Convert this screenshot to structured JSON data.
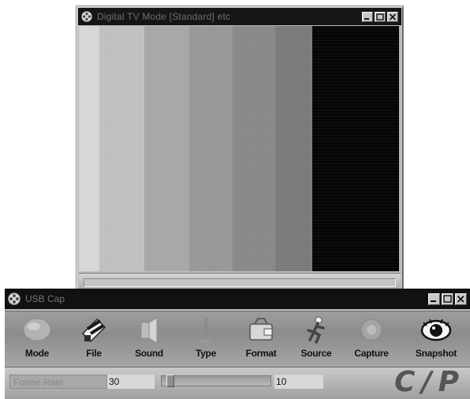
{
  "preview_window": {
    "title": "Digital TV Mode [Standard] etc",
    "color_bars": [
      {
        "color": "#d9d9d9",
        "fraction": 0.065
      },
      {
        "color": "#c2c2c2",
        "fraction": 0.14
      },
      {
        "color": "#a9a9a9",
        "fraction": 0.14
      },
      {
        "color": "#999999",
        "fraction": 0.135
      },
      {
        "color": "#8a8a8a",
        "fraction": 0.135
      },
      {
        "color": "#7c7c7c",
        "fraction": 0.115
      },
      {
        "color": "#060606",
        "fraction": 0.27
      }
    ]
  },
  "toolbar_window": {
    "title": "USB Cap",
    "tools": [
      {
        "label": "Mode",
        "icon": "mode-icon"
      },
      {
        "label": "File",
        "icon": "file-icon"
      },
      {
        "label": "Sound",
        "icon": "sound-icon"
      },
      {
        "label": "Type",
        "icon": "type-icon"
      },
      {
        "label": "Format",
        "icon": "format-icon"
      },
      {
        "label": "Source",
        "icon": "source-icon"
      },
      {
        "label": "Capture",
        "icon": "capture-icon"
      },
      {
        "label": "Snapshot",
        "icon": "snapshot-icon"
      }
    ],
    "field_left": "Frame Rate",
    "value_1": "30",
    "value_2": "10",
    "slider_level": 0.05,
    "logo_text": "C/P"
  }
}
